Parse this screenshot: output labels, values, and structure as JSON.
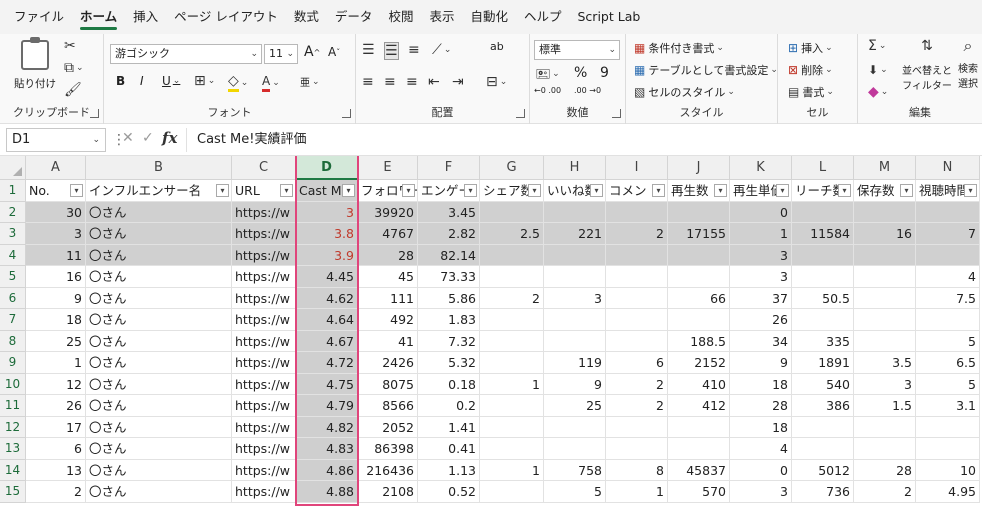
{
  "menu": [
    "ファイル",
    "ホーム",
    "挿入",
    "ページ レイアウト",
    "数式",
    "データ",
    "校閲",
    "表示",
    "自動化",
    "ヘルプ",
    "Script Lab"
  ],
  "active_menu": "ホーム",
  "ribbon": {
    "clipboard": {
      "paste": "貼り付け",
      "label": "クリップボード"
    },
    "font": {
      "name": "游ゴシック",
      "size": "11",
      "bold": "B",
      "italic": "I",
      "underline": "U",
      "label": "フォント",
      "grow": "A",
      "shrink": "A",
      "phonetic": "亜"
    },
    "alignment": {
      "label": "配置",
      "wrap": "ab"
    },
    "number": {
      "format": "標準",
      "percent": "%",
      "comma": "9",
      "inc": "←0 .00",
      "dec": ".00 →0",
      "label": "数値"
    },
    "styles": {
      "conditional": "条件付き書式",
      "table": "テーブルとして書式設定",
      "cell": "セルのスタイル",
      "label": "スタイル"
    },
    "cells": {
      "insert": "挿入",
      "delete": "削除",
      "format": "書式",
      "label": "セル"
    },
    "editing": {
      "sort": "並べ替えと",
      "filter": "フィルター",
      "find": "検索",
      "select": "選択",
      "label": "編集"
    }
  },
  "formula_bar": {
    "name_box": "D1",
    "content": "Cast Me!実績評価"
  },
  "columns": [
    "A",
    "B",
    "C",
    "D",
    "E",
    "F",
    "G",
    "H",
    "I",
    "J",
    "K",
    "L",
    "M",
    "N"
  ],
  "selected_column": "D",
  "header_row": [
    "No.",
    "インフルエンサー名",
    "URL",
    "Cast Me!",
    "フォロワー",
    "エンゲー",
    "シェア数",
    "いいね数",
    "コメン",
    "再生数",
    "再生単価",
    "リーチ数",
    "保存数",
    "視聴時間"
  ],
  "rows": [
    {
      "n": "2",
      "cells": [
        "30",
        "〇さん",
        "https://w",
        "3",
        "39920",
        "3.45",
        "",
        "",
        "",
        "",
        "0",
        "",
        "",
        ""
      ]
    },
    {
      "n": "3",
      "cells": [
        "3",
        "〇さん",
        "https://w",
        "3.8",
        "4767",
        "2.82",
        "2.5",
        "221",
        "2",
        "17155",
        "1",
        "11584",
        "16",
        "7"
      ]
    },
    {
      "n": "4",
      "cells": [
        "11",
        "〇さん",
        "https://w",
        "3.9",
        "28",
        "82.14",
        "",
        "",
        "",
        "",
        "3",
        "",
        "",
        ""
      ]
    },
    {
      "n": "5",
      "cells": [
        "16",
        "〇さん",
        "https://w",
        "4.45",
        "45",
        "73.33",
        "",
        "",
        "",
        "",
        "3",
        "",
        "",
        "4"
      ]
    },
    {
      "n": "6",
      "cells": [
        "9",
        "〇さん",
        "https://w",
        "4.62",
        "111",
        "5.86",
        "2",
        "3",
        "",
        "66",
        "37",
        "50.5",
        "",
        "7.5"
      ]
    },
    {
      "n": "7",
      "cells": [
        "18",
        "〇さん",
        "https://w",
        "4.64",
        "492",
        "1.83",
        "",
        "",
        "",
        "",
        "26",
        "",
        "",
        ""
      ]
    },
    {
      "n": "8",
      "cells": [
        "25",
        "〇さん",
        "https://w",
        "4.67",
        "41",
        "7.32",
        "",
        "",
        "",
        "188.5",
        "34",
        "335",
        "",
        "5"
      ]
    },
    {
      "n": "9",
      "cells": [
        "1",
        "〇さん",
        "https://w",
        "4.72",
        "2426",
        "5.32",
        "",
        "119",
        "6",
        "2152",
        "9",
        "1891",
        "3.5",
        "6.5"
      ]
    },
    {
      "n": "10",
      "cells": [
        "12",
        "〇さん",
        "https://w",
        "4.75",
        "8075",
        "0.18",
        "1",
        "9",
        "2",
        "410",
        "18",
        "540",
        "3",
        "5"
      ]
    },
    {
      "n": "11",
      "cells": [
        "26",
        "〇さん",
        "https://w",
        "4.79",
        "8566",
        "0.2",
        "",
        "25",
        "2",
        "412",
        "28",
        "386",
        "1.5",
        "3.1"
      ]
    },
    {
      "n": "12",
      "cells": [
        "17",
        "〇さん",
        "https://w",
        "4.82",
        "2052",
        "1.41",
        "",
        "",
        "",
        "",
        "18",
        "",
        "",
        ""
      ]
    },
    {
      "n": "13",
      "cells": [
        "6",
        "〇さん",
        "https://w",
        "4.83",
        "86398",
        "0.41",
        "",
        "",
        "",
        "",
        "4",
        "",
        "",
        ""
      ]
    },
    {
      "n": "14",
      "cells": [
        "13",
        "〇さん",
        "https://w",
        "4.86",
        "216436",
        "1.13",
        "1",
        "758",
        "8",
        "45837",
        "0",
        "5012",
        "28",
        "10"
      ]
    },
    {
      "n": "15",
      "cells": [
        "2",
        "〇さん",
        "https://w",
        "4.88",
        "2108",
        "0.52",
        "",
        "5",
        "1",
        "570",
        "3",
        "736",
        "2",
        "4.95"
      ]
    }
  ],
  "shaded_rows": [
    "2",
    "3",
    "4"
  ],
  "colors": {
    "accent": "#1e7a44",
    "selection": "#e0457b",
    "shade": "#d0d0d0",
    "red_text": "#c0392b"
  }
}
